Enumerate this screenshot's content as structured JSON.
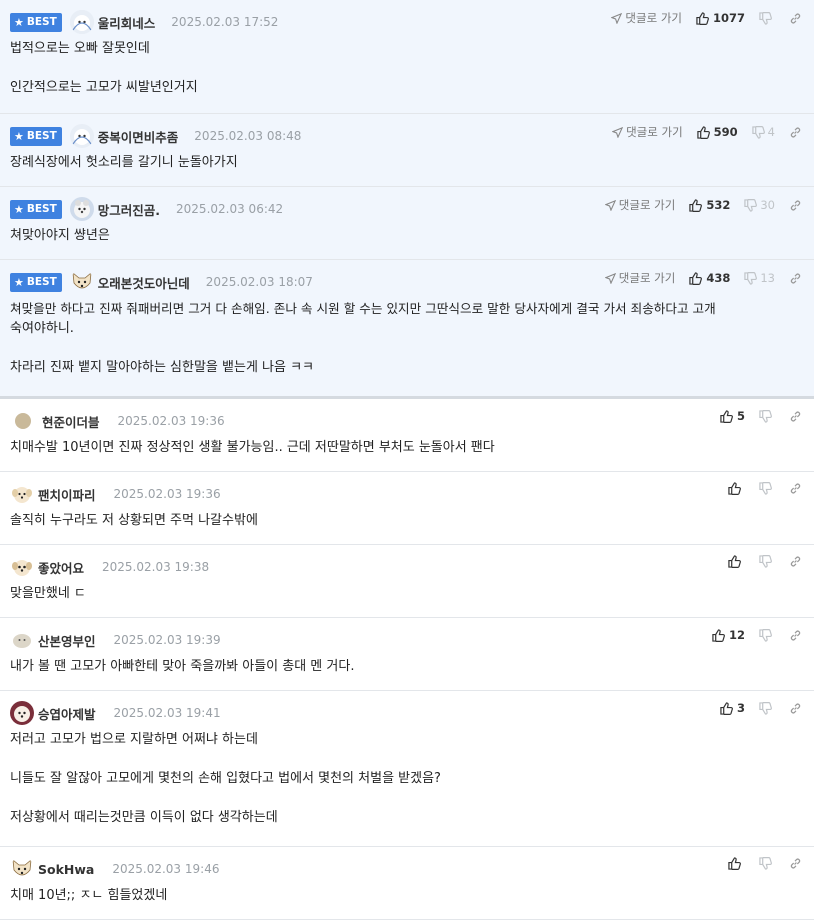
{
  "best_label": "BEST",
  "reply_label": "댓글로 가기",
  "best_comments": [
    {
      "nick": "울리회네스",
      "date": "2025.02.03 17:52",
      "up": "1077",
      "down": "",
      "lines": [
        "법적으로는 오빠 잘못인데",
        "",
        "인간적으로는 고모가 씨발년인거지"
      ]
    },
    {
      "nick": "중복이면비추좀",
      "date": "2025.02.03 08:48",
      "up": "590",
      "down": "4",
      "lines": [
        "장례식장에서 헛소리를 갈기니 눈돌아가지"
      ]
    },
    {
      "nick": "망그러진곰.",
      "date": "2025.02.03 06:42",
      "up": "532",
      "down": "30",
      "lines": [
        "쳐맞아야지 썅년은"
      ]
    },
    {
      "nick": "오래본것도아닌데",
      "date": "2025.02.03 18:07",
      "up": "438",
      "down": "13",
      "lines": [
        "쳐맞을만 하다고 진짜 줘패버리면 그거 다 손해임. 존나 속 시원 할 수는 있지만 그딴식으로 말한 당사자에게 결국 가서 죄송하다고 고개",
        "숙여야하니.",
        "",
        "차라리 진짜 뱉지 말아야하는 심한말을 뱉는게 나음 ㅋㅋ"
      ]
    }
  ],
  "comments": [
    {
      "nick": "현준이더블",
      "date": "2025.02.03 19:36",
      "up": "5",
      "lines": [
        "치매수발 10년이면 진짜 정상적인 생활 불가능임.. 근데 저딴말하면 부처도 눈돌아서 팬다"
      ]
    },
    {
      "nick": "팬치이파리",
      "date": "2025.02.03 19:36",
      "up": "",
      "lines": [
        "솔직히 누구라도 저 상황되면 주먹 나갈수밖에"
      ]
    },
    {
      "nick": "좋았어요",
      "date": "2025.02.03 19:38",
      "up": "",
      "lines": [
        "맞을만했네 ㄷ"
      ]
    },
    {
      "nick": "산본영부인",
      "date": "2025.02.03 19:39",
      "up": "12",
      "lines": [
        "내가 볼 땐 고모가 아빠한테 맞아 죽을까봐 아들이 총대 멘 거다."
      ]
    },
    {
      "nick": "승엽아제발",
      "date": "2025.02.03 19:41",
      "up": "3",
      "lines": [
        "저러고 고모가 법으로 지랄하면 어쩌냐 하는데",
        "",
        "니들도 잘 알잖아 고모에게 몇천의 손해 입혔다고 법에서 몇천의 처벌을 받겠음?",
        "",
        "저상황에서 때리는것만큼 이득이 없다 생각하는데"
      ]
    },
    {
      "nick": "SokHwa",
      "date": "2025.02.03 19:46",
      "up": "",
      "lines": [
        "치매 10년;; ㅈㄴ 힘들었겠네"
      ]
    }
  ],
  "icons": {
    "reply": "reply-arrow-icon",
    "up": "thumbs-up-icon",
    "down": "thumbs-down-icon",
    "link": "link-icon"
  },
  "colors": {
    "best_badge": "#3f82e0",
    "best_bg": "#f1f6fd",
    "date": "#9aa0a6"
  }
}
